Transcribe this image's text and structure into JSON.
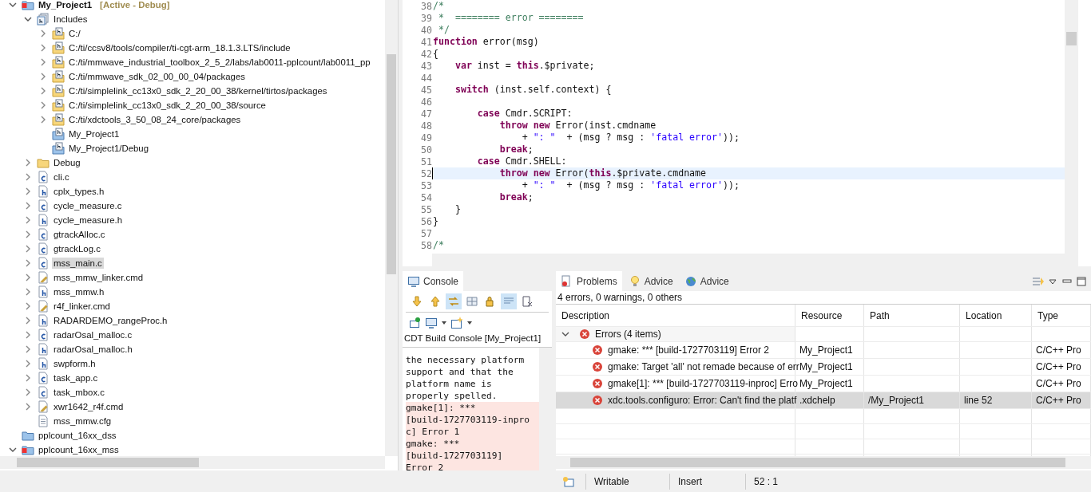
{
  "project_explorer": {
    "tree": [
      {
        "label": "My_Project1",
        "note": "[Active - Debug]",
        "kind": "project",
        "expanded": true,
        "selected": false,
        "children": [
          {
            "label": "Includes",
            "kind": "includes",
            "expanded": true,
            "selected": false,
            "children": [
              {
                "label": "C:/",
                "kind": "include-folder",
                "expanded": false,
                "selected": false
              },
              {
                "label": "C:/ti/ccsv8/tools/compiler/ti-cgt-arm_18.1.3.LTS/include",
                "kind": "include-folder",
                "expanded": false,
                "selected": false
              },
              {
                "label": "C:/ti/mmwave_industrial_toolbox_2_5_2/labs/lab0011-pplcount/lab0011_pp",
                "kind": "include-folder",
                "expanded": false,
                "selected": false
              },
              {
                "label": "C:/ti/mmwave_sdk_02_00_00_04/packages",
                "kind": "include-folder",
                "expanded": false,
                "selected": false
              },
              {
                "label": "C:/ti/simplelink_cc13x0_sdk_2_20_00_38/kernel/tirtos/packages",
                "kind": "include-folder",
                "expanded": false,
                "selected": false
              },
              {
                "label": "C:/ti/simplelink_cc13x0_sdk_2_20_00_38/source",
                "kind": "include-folder",
                "expanded": false,
                "selected": false
              },
              {
                "label": "C:/ti/xdctools_3_50_08_24_core/packages",
                "kind": "include-folder",
                "expanded": false,
                "selected": false
              },
              {
                "label": "My_Project1",
                "kind": "include-project",
                "selected": false
              },
              {
                "label": "My_Project1/Debug",
                "kind": "include-project",
                "selected": false
              }
            ]
          },
          {
            "label": "Debug",
            "kind": "folder",
            "expanded": false,
            "selected": false
          },
          {
            "label": "cli.c",
            "kind": "c-file",
            "expanded": false,
            "selected": false
          },
          {
            "label": "cplx_types.h",
            "kind": "h-file",
            "expanded": false,
            "selected": false
          },
          {
            "label": "cycle_measure.c",
            "kind": "c-file",
            "expanded": false,
            "selected": false
          },
          {
            "label": "cycle_measure.h",
            "kind": "h-file",
            "expanded": false,
            "selected": false
          },
          {
            "label": "gtrackAlloc.c",
            "kind": "c-file",
            "expanded": false,
            "selected": false
          },
          {
            "label": "gtrackLog.c",
            "kind": "c-file",
            "expanded": false,
            "selected": false
          },
          {
            "label": "mss_main.c",
            "kind": "c-file",
            "expanded": false,
            "selected": true
          },
          {
            "label": "mss_mmw_linker.cmd",
            "kind": "cmd-file",
            "expanded": false,
            "selected": false
          },
          {
            "label": "mss_mmw.h",
            "kind": "h-file",
            "expanded": false,
            "selected": false
          },
          {
            "label": "r4f_linker.cmd",
            "kind": "cmd-file",
            "expanded": false,
            "selected": false
          },
          {
            "label": "RADARDEMO_rangeProc.h",
            "kind": "h-file",
            "expanded": false,
            "selected": false
          },
          {
            "label": "radarOsal_malloc.c",
            "kind": "c-file",
            "expanded": false,
            "selected": false
          },
          {
            "label": "radarOsal_malloc.h",
            "kind": "h-file",
            "expanded": false,
            "selected": false
          },
          {
            "label": "swpform.h",
            "kind": "h-file",
            "expanded": false,
            "selected": false
          },
          {
            "label": "task_app.c",
            "kind": "c-file",
            "expanded": false,
            "selected": false
          },
          {
            "label": "task_mbox.c",
            "kind": "c-file",
            "expanded": false,
            "selected": false
          },
          {
            "label": "xwr1642_r4f.cmd",
            "kind": "cmd-file",
            "expanded": false,
            "selected": false
          },
          {
            "label": "mss_mmw.cfg",
            "kind": "cfg-file",
            "selected": false
          }
        ]
      },
      {
        "label": "pplcount_16xx_dss",
        "kind": "closed-project",
        "selected": false
      },
      {
        "label": "pplcount_16xx_mss",
        "kind": "project",
        "expanded": true,
        "selected": false
      }
    ]
  },
  "editor": {
    "lines": [
      {
        "n": "38",
        "current": false,
        "parts": [
          {
            "kind": "comment",
            "t": "/*"
          }
        ]
      },
      {
        "n": "39",
        "current": false,
        "parts": [
          {
            "kind": "comment",
            "t": " *  ======== error ========"
          }
        ]
      },
      {
        "n": "40",
        "current": false,
        "parts": [
          {
            "kind": "comment",
            "t": " */"
          }
        ]
      },
      {
        "n": "41",
        "current": false,
        "parts": [
          {
            "kind": "keyword",
            "t": "function"
          },
          {
            "kind": "plain",
            "t": " error(msg)"
          }
        ]
      },
      {
        "n": "42",
        "current": false,
        "parts": [
          {
            "kind": "plain",
            "t": "{"
          }
        ]
      },
      {
        "n": "43",
        "current": false,
        "parts": [
          {
            "kind": "keyword",
            "t": "    var"
          },
          {
            "kind": "plain",
            "t": " inst = "
          },
          {
            "kind": "keyword",
            "t": "this"
          },
          {
            "kind": "plain",
            "t": ".$private;"
          }
        ]
      },
      {
        "n": "44",
        "current": false
      },
      {
        "n": "45",
        "current": false,
        "parts": [
          {
            "kind": "keyword",
            "t": "    switch"
          },
          {
            "kind": "plain",
            "t": " (inst.self.context) {"
          }
        ]
      },
      {
        "n": "46",
        "current": false
      },
      {
        "n": "47",
        "current": false,
        "parts": [
          {
            "kind": "keyword",
            "t": "        case"
          },
          {
            "kind": "plain",
            "t": " Cmdr.SCRIPT:"
          }
        ]
      },
      {
        "n": "48",
        "current": false,
        "parts": [
          {
            "kind": "keyword",
            "t": "            throw"
          },
          {
            "kind": "keyword",
            "t": " new"
          },
          {
            "kind": "plain",
            "t": " Error(inst.cmdname"
          }
        ]
      },
      {
        "n": "49",
        "current": false,
        "parts": [
          {
            "kind": "plain",
            "t": "                + "
          },
          {
            "kind": "string",
            "t": "\": \""
          },
          {
            "kind": "plain",
            "t": "  + (msg ? msg : "
          },
          {
            "kind": "string",
            "t": "'fatal error'"
          },
          {
            "kind": "plain",
            "t": "));"
          }
        ]
      },
      {
        "n": "50",
        "current": false,
        "parts": [
          {
            "kind": "keyword",
            "t": "            break"
          },
          {
            "kind": "plain",
            "t": ";"
          }
        ]
      },
      {
        "n": "51",
        "current": false,
        "parts": [
          {
            "kind": "keyword",
            "t": "        case"
          },
          {
            "kind": "plain",
            "t": " Cmdr.SHELL:"
          }
        ]
      },
      {
        "n": "52",
        "current": true,
        "parts": [
          {
            "kind": "keyword",
            "t": "            throw"
          },
          {
            "kind": "keyword",
            "t": " new"
          },
          {
            "kind": "plain",
            "t": " Error("
          },
          {
            "kind": "keyword",
            "t": "this"
          },
          {
            "kind": "plain",
            "t": ".$private.cmdname"
          }
        ]
      },
      {
        "n": "53",
        "current": false,
        "parts": [
          {
            "kind": "plain",
            "t": "                + "
          },
          {
            "kind": "string",
            "t": "\": \""
          },
          {
            "kind": "plain",
            "t": "  + (msg ? msg : "
          },
          {
            "kind": "string",
            "t": "'fatal error'"
          },
          {
            "kind": "plain",
            "t": "));"
          }
        ]
      },
      {
        "n": "54",
        "current": false,
        "parts": [
          {
            "kind": "keyword",
            "t": "            break"
          },
          {
            "kind": "plain",
            "t": ";"
          }
        ]
      },
      {
        "n": "55",
        "current": false,
        "parts": [
          {
            "kind": "plain",
            "t": "    }"
          }
        ]
      },
      {
        "n": "56",
        "current": false,
        "parts": [
          {
            "kind": "plain",
            "t": "}"
          }
        ]
      },
      {
        "n": "57",
        "current": false
      },
      {
        "n": "58",
        "current": false,
        "parts": [
          {
            "kind": "comment",
            "t": "/*"
          }
        ]
      }
    ]
  },
  "console": {
    "tab": {
      "label": "Console",
      "selected": true
    },
    "toolbar": [
      {
        "kind": "down-arrow",
        "on": false
      },
      {
        "kind": "up-arrow",
        "on": false
      },
      {
        "kind": "swap",
        "on": true
      },
      {
        "kind": "grid",
        "on": false
      },
      {
        "kind": "lock",
        "on": false
      },
      {
        "kind": "lines",
        "on": true
      },
      {
        "kind": "clear",
        "on": false
      }
    ],
    "title": "CDT Build Console [My_Project1]",
    "lines": [
      {
        "kind": "info",
        "text": "the necessary platform"
      },
      {
        "kind": "info",
        "text": "support and that the"
      },
      {
        "kind": "info",
        "text": "platform name is"
      },
      {
        "kind": "info",
        "text": "properly spelled."
      },
      {
        "kind": "error",
        "text": "gmake[1]: ***"
      },
      {
        "kind": "error",
        "text": "[build-1727703119-inpro"
      },
      {
        "kind": "error",
        "text": "c] Error 1"
      },
      {
        "kind": "error",
        "text": "gmake: ***"
      },
      {
        "kind": "error",
        "text": "[build-1727703119]"
      },
      {
        "kind": "error",
        "text": "Error 2"
      }
    ]
  },
  "problems": {
    "tabs": [
      {
        "label": "Problems",
        "kind": "problems",
        "selected": true
      },
      {
        "label": "Advice",
        "kind": "bulb",
        "selected": false
      },
      {
        "label": "Advice",
        "kind": "globe",
        "selected": false
      }
    ],
    "summary": "4 errors, 0 warnings, 0 others",
    "columns": [
      "Description",
      "Resource",
      "Path",
      "Location",
      "Type"
    ],
    "group": {
      "label": "Errors (4 items)",
      "expanded": true,
      "rows": [
        {
          "description": "gmake: *** [build-1727703119] Error 2",
          "resource": "My_Project1",
          "type": "C/C++ Pro",
          "selected": false
        },
        {
          "description": "gmake: Target 'all' not remade because of err",
          "resource": "My_Project1",
          "type": "C/C++ Pro",
          "selected": false
        },
        {
          "description": "gmake[1]: *** [build-1727703119-inproc] Erro",
          "resource": "My_Project1",
          "type": "C/C++ Pro",
          "selected": false
        },
        {
          "description": "xdc.tools.configuro: Error: Can't find the platf",
          "resource": ".xdchelp",
          "path": "/My_Project1",
          "location": "line 52",
          "type": "C/C++ Pro",
          "selected": true
        }
      ]
    }
  },
  "status_bar": {
    "fields": [
      "Writable",
      "Insert",
      "52 : 1"
    ]
  }
}
